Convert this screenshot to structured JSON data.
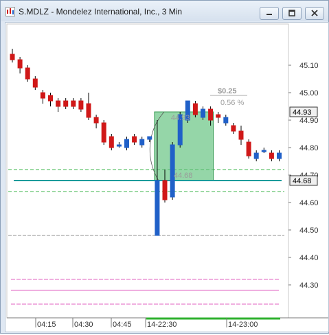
{
  "window": {
    "title": "S.MDLZ - Mondelez International, Inc., 3 Min",
    "buttons": [
      "minimize",
      "restore",
      "close"
    ]
  },
  "colors": {
    "up": "#2060c8",
    "down": "#d01818",
    "box": "#5cc07a",
    "teal": "#189b9b",
    "green_dash": "#3cb44b",
    "pink": "#e060c0",
    "gray_dash": "#909090"
  },
  "chart_data": {
    "type": "candlestick",
    "y_ticks": [
      "45.10",
      "45.00",
      "44.90",
      "44.80",
      "44.70",
      "44.60",
      "44.50",
      "44.40",
      "44.30"
    ],
    "ylim": [
      44.18,
      45.25
    ],
    "x_ticks": [
      "04:15",
      "04:30",
      "04:45",
      "14-22:30",
      "14-23:00"
    ],
    "price_tags": [
      {
        "label": "44.93",
        "value": 44.93
      },
      {
        "label": "44.68",
        "value": 44.68
      }
    ],
    "annotations": {
      "change": "$0.25",
      "pct_partial": "0.56 %",
      "box_low_label": "44.68",
      "box_high_label": "44.93"
    },
    "candles": [
      {
        "o": 45.14,
        "h": 45.16,
        "l": 45.11,
        "c": 45.12
      },
      {
        "o": 45.12,
        "h": 45.13,
        "l": 45.07,
        "c": 45.09
      },
      {
        "o": 45.09,
        "h": 45.1,
        "l": 45.04,
        "c": 45.05
      },
      {
        "o": 45.05,
        "h": 45.06,
        "l": 45.01,
        "c": 45.02
      },
      {
        "o": 45.0,
        "h": 45.01,
        "l": 44.96,
        "c": 44.98
      },
      {
        "o": 44.99,
        "h": 45.0,
        "l": 44.95,
        "c": 44.97
      },
      {
        "o": 44.97,
        "h": 44.98,
        "l": 44.93,
        "c": 44.95
      },
      {
        "o": 44.97,
        "h": 44.98,
        "l": 44.94,
        "c": 44.95
      },
      {
        "o": 44.97,
        "h": 44.98,
        "l": 44.94,
        "c": 44.95
      },
      {
        "o": 44.97,
        "h": 44.98,
        "l": 44.93,
        "c": 44.94
      },
      {
        "o": 44.96,
        "h": 45.0,
        "l": 44.9,
        "c": 44.91
      },
      {
        "o": 44.91,
        "h": 44.92,
        "l": 44.87,
        "c": 44.89
      },
      {
        "o": 44.89,
        "h": 44.9,
        "l": 44.81,
        "c": 44.82
      },
      {
        "o": 44.84,
        "h": 44.85,
        "l": 44.79,
        "c": 44.8
      },
      {
        "o": 44.81,
        "h": 44.82,
        "l": 44.8,
        "c": 44.81
      },
      {
        "o": 44.8,
        "h": 44.84,
        "l": 44.79,
        "c": 44.83
      },
      {
        "o": 44.84,
        "h": 44.85,
        "l": 44.81,
        "c": 44.82
      },
      {
        "o": 44.81,
        "h": 44.84,
        "l": 44.8,
        "c": 44.83
      },
      {
        "o": 44.83,
        "h": 44.84,
        "l": 44.82,
        "c": 44.84
      },
      {
        "o": 44.48,
        "h": 44.9,
        "l": 44.48,
        "c": 44.68
      },
      {
        "o": 44.68,
        "h": 44.72,
        "l": 44.6,
        "c": 44.61
      },
      {
        "o": 44.62,
        "h": 44.82,
        "l": 44.61,
        "c": 44.81
      },
      {
        "o": 44.81,
        "h": 44.93,
        "l": 44.8,
        "c": 44.92
      },
      {
        "o": 44.9,
        "h": 44.97,
        "l": 44.89,
        "c": 44.97
      },
      {
        "o": 44.96,
        "h": 44.97,
        "l": 44.91,
        "c": 44.92
      },
      {
        "o": 44.91,
        "h": 44.95,
        "l": 44.9,
        "c": 44.94
      },
      {
        "o": 44.94,
        "h": 44.95,
        "l": 44.88,
        "c": 44.9
      },
      {
        "o": 44.92,
        "h": 44.93,
        "l": 44.89,
        "c": 44.91
      },
      {
        "o": 44.89,
        "h": 44.92,
        "l": 44.88,
        "c": 44.91
      },
      {
        "o": 44.88,
        "h": 44.89,
        "l": 44.85,
        "c": 44.86
      },
      {
        "o": 44.86,
        "h": 44.88,
        "l": 44.81,
        "c": 44.83
      },
      {
        "o": 44.82,
        "h": 44.83,
        "l": 44.76,
        "c": 44.77
      },
      {
        "o": 44.76,
        "h": 44.79,
        "l": 44.75,
        "c": 44.78
      },
      {
        "o": 44.79,
        "h": 44.8,
        "l": 44.78,
        "c": 44.79
      },
      {
        "o": 44.78,
        "h": 44.79,
        "l": 44.75,
        "c": 44.76
      },
      {
        "o": 44.76,
        "h": 44.79,
        "l": 44.75,
        "c": 44.78
      }
    ],
    "levels": {
      "green_dashed": [
        44.72,
        44.64
      ],
      "teal_solid": [
        44.68
      ],
      "gray_dashed": [
        44.48
      ],
      "pink": [
        44.32,
        44.28,
        44.23
      ]
    },
    "range_box": {
      "from_index": 19,
      "to_index": 26,
      "low": 44.68,
      "high": 44.93
    }
  }
}
